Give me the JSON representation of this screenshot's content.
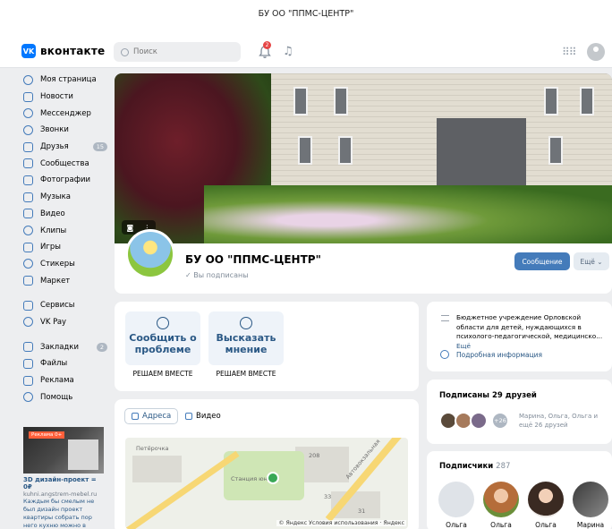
{
  "window": {
    "title": "БУ ОО \"ППМС-ЦЕНТР\""
  },
  "topbar": {
    "logo_text": "вконтакте",
    "search_placeholder": "Поиск",
    "notifications_count": "2"
  },
  "sidebar": {
    "items": [
      {
        "label": "Моя страница"
      },
      {
        "label": "Новости"
      },
      {
        "label": "Мессенджер"
      },
      {
        "label": "Звонки"
      },
      {
        "label": "Друзья",
        "badge": "15"
      },
      {
        "label": "Сообщества"
      },
      {
        "label": "Фотографии"
      },
      {
        "label": "Музыка"
      },
      {
        "label": "Видео"
      },
      {
        "label": "Клипы"
      },
      {
        "label": "Игры"
      },
      {
        "label": "Стикеры"
      },
      {
        "label": "Маркет"
      }
    ],
    "items2": [
      {
        "label": "Сервисы"
      },
      {
        "label": "VK Pay"
      }
    ],
    "items3": [
      {
        "label": "Закладки",
        "badge": "2"
      },
      {
        "label": "Файлы"
      },
      {
        "label": "Реклама"
      },
      {
        "label": "Помощь"
      }
    ]
  },
  "ad": {
    "badge": "Реклама 0+",
    "title": "3D дизайн-проект = 0₽",
    "url": "kuhni.angstrem-mebel.ru",
    "description": "Каждым бы смелым не был дизайн проект квартиры собрать пор него кухню можно в"
  },
  "profile": {
    "name": "БУ ОО \"ППМС-ЦЕНТР\"",
    "status": "Вы подписаны",
    "message_button": "Сообщение",
    "more_button": "Ещё"
  },
  "actions": [
    {
      "label": "Сообщить о проблеме",
      "caption": "РЕШАЕМ ВМЕСТЕ"
    },
    {
      "label": "Высказать мнение",
      "caption": "РЕШАЕМ ВМЕСТЕ"
    }
  ],
  "map_card": {
    "tabs": [
      {
        "label": "Адреса"
      },
      {
        "label": "Видео"
      }
    ],
    "labels": {
      "petrovich": "Петёрочка",
      "station": "Станция юннат",
      "road": "Автовокзальная",
      "n208": "208",
      "n33": "33",
      "n31": "31"
    },
    "copyright": "© Яндекс Условия использования · Яндекс"
  },
  "about": {
    "description": "Бюджетное учреждение Орловской области для детей, нуждающихся в психолого-педагогической, медицинско...",
    "more": "Ещё",
    "info_link": "Подробная информация"
  },
  "friends": {
    "title": "Подписаны 29 друзей",
    "extra_count": "+26",
    "names": "Марина, Ольга, Ольга и ещё 26 друзей"
  },
  "subscribers": {
    "title": "Подписчики",
    "count": "287",
    "people": [
      {
        "name": "Ольга"
      },
      {
        "name": "Ольга"
      },
      {
        "name": "Ольга"
      },
      {
        "name": "Марина"
      }
    ]
  }
}
